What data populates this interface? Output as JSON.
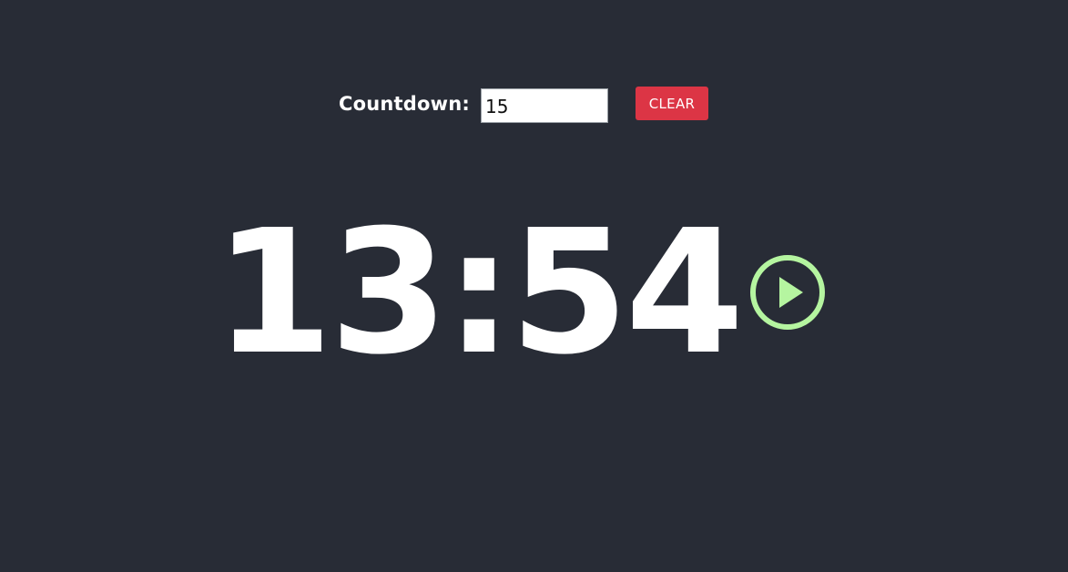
{
  "countdown": {
    "label": "Countdown:",
    "input_value": "15",
    "clear_label": "CLEAR"
  },
  "timer": {
    "display": "13:54"
  },
  "icons": {
    "play": "play-circle-icon"
  },
  "colors": {
    "background": "#282c36",
    "clear_button": "#dc3545",
    "play_icon": "#b5f5a0",
    "timer_text": "#ffffff"
  }
}
